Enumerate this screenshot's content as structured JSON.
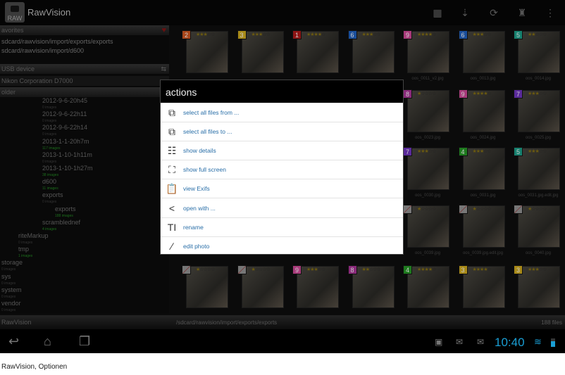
{
  "app": {
    "title": "RawVision",
    "icon_text": "RAW"
  },
  "actionbar_icons": [
    "grid-view-icon",
    "sort-icon",
    "refresh-icon",
    "stamp-icon",
    "overflow-menu-icon"
  ],
  "sidebar": {
    "favorites_label": "avorites",
    "favorites": [
      "sdcard/rawvision/import/exports/exports",
      "sdcard/rawvision/import/d600"
    ],
    "usb_label": "USB device",
    "usb_device": "Nikon Corporation D7000",
    "folder_label": "older",
    "folders": [
      {
        "name": "2012-9-6-20h45",
        "count": "0 images",
        "green": false,
        "level": 2
      },
      {
        "name": "2012-9-6-22h11",
        "count": "0 images",
        "green": false,
        "level": 2
      },
      {
        "name": "2012-9-6-22h14",
        "count": "0 images",
        "green": false,
        "level": 2
      },
      {
        "name": "2013-1-1-20h7m",
        "count": "117 images",
        "green": true,
        "level": 2
      },
      {
        "name": "2013-1-10-1h11m",
        "count": "0 images",
        "green": false,
        "level": 2
      },
      {
        "name": "2013-1-10-1h27m",
        "count": "38 images",
        "green": true,
        "level": 2
      },
      {
        "name": "d600",
        "count": "11 images",
        "green": true,
        "level": 2
      },
      {
        "name": "exports",
        "count": "0 images",
        "green": false,
        "level": 2
      },
      {
        "name": "exports",
        "count": "188 images",
        "green": true,
        "level": 3
      },
      {
        "name": "scramblednef",
        "count": "4 images",
        "green": true,
        "level": 2
      },
      {
        "name": "riteMarkup",
        "count": "0 images",
        "green": false,
        "level": 1
      },
      {
        "name": "tmp",
        "count": "1 images",
        "green": true,
        "level": 1
      },
      {
        "name": "storage",
        "count": "0 images",
        "green": false,
        "level": 0
      },
      {
        "name": "sys",
        "count": "0 images",
        "green": false,
        "level": 0
      },
      {
        "name": "system",
        "count": "0 images",
        "green": false,
        "level": 0
      },
      {
        "name": "vendor",
        "count": "0 images",
        "green": false,
        "level": 0
      }
    ],
    "footer": "RawVision"
  },
  "grid": {
    "rows": [
      [
        {
          "label": "2",
          "color": "#a8461a",
          "stars": 3
        },
        {
          "label": "3",
          "color": "#a88a18",
          "stars": 3
        },
        {
          "label": "1",
          "color": "#8e1515",
          "stars": 4
        },
        {
          "label": "6",
          "color": "#1a4e9a",
          "stars": 3
        },
        {
          "label": "9",
          "color": "#a83a7a",
          "stars": 4,
          "name": "oos_0011_v2.jpg"
        },
        {
          "label": "6",
          "color": "#1a4e9a",
          "stars": 3,
          "name": "oos_0013.jpg"
        },
        {
          "label": "5",
          "color": "#16806e",
          "stars": 2,
          "name": "oos_0014.jpg"
        }
      ],
      [
        null,
        null,
        null,
        null,
        {
          "label": "8",
          "color": "#8a2a7a",
          "stars": 1,
          "name": "oos_0023.jpg"
        },
        {
          "label": "9",
          "color": "#a83a7a",
          "stars": 4,
          "name": "oos_0024.jpg"
        },
        {
          "label": "7",
          "color": "#5a2a9a",
          "stars": 3,
          "name": "oos_0025.jpg"
        }
      ],
      [
        null,
        null,
        null,
        null,
        {
          "label": "7",
          "color": "#5a2a9a",
          "stars": 3,
          "name": "oos_0030.jpg"
        },
        {
          "label": "4",
          "color": "#1e7a1e",
          "stars": 3,
          "name": "oos_0031.jpg"
        },
        {
          "label": "5",
          "color": "#16806e",
          "stars": 3,
          "name": "oos_0031.jpg.edit.jpg"
        }
      ],
      [
        null,
        null,
        null,
        null,
        {
          "label": "",
          "color": "#777",
          "stars": 1,
          "name": "oos_0039.jpg"
        },
        {
          "label": "",
          "color": "#777",
          "stars": 1,
          "name": "oos_0039.jpg.edit.jpg"
        },
        {
          "label": "",
          "color": "#777",
          "stars": 1,
          "name": "oos_0040.jpg"
        }
      ],
      [
        {
          "label": "",
          "color": "#777",
          "stars": 1
        },
        {
          "label": "",
          "color": "#777",
          "stars": 1
        },
        {
          "label": "9",
          "color": "#a83a7a",
          "stars": 3
        },
        {
          "label": "8",
          "color": "#8a2a7a",
          "stars": 2
        },
        {
          "label": "4",
          "color": "#1e7a1e",
          "stars": 4
        },
        {
          "label": "3",
          "color": "#a88a18",
          "stars": 4
        },
        {
          "label": "3",
          "color": "#a88a18",
          "stars": 3
        }
      ]
    ]
  },
  "pathbar": {
    "path": "/sdcard/rawvision/import/exports/exports",
    "count": "188 files"
  },
  "dialog": {
    "title": "actions",
    "items": [
      {
        "label": "select all files from ...",
        "icon": "select-from-icon",
        "glyph": "⧉"
      },
      {
        "label": "select all files to ...",
        "icon": "select-to-icon",
        "glyph": "⧉"
      },
      {
        "label": "show details",
        "icon": "details-icon",
        "glyph": "☷"
      },
      {
        "label": "show full screen",
        "icon": "fullscreen-icon",
        "glyph": "⛶"
      },
      {
        "label": "view Exifs",
        "icon": "clipboard-icon",
        "glyph": "📋"
      },
      {
        "label": "open with ...",
        "icon": "share-icon",
        "glyph": "<"
      },
      {
        "label": "rename",
        "icon": "rename-icon",
        "glyph": "TI"
      },
      {
        "label": "edit photo",
        "icon": "edit-photo-icon",
        "glyph": "∕"
      }
    ]
  },
  "statusbar": {
    "time": "10:40"
  },
  "caption": "RawVision, Optionen"
}
